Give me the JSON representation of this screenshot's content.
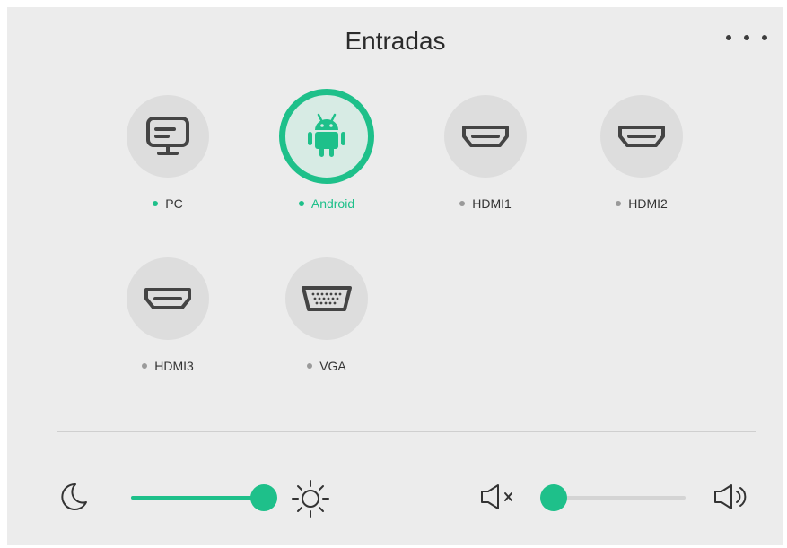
{
  "header": {
    "title": "Entradas",
    "more_icon": "more-horizontal-icon"
  },
  "sources": [
    {
      "label": "PC",
      "icon": "monitor-icon",
      "status": "available"
    },
    {
      "label": "Android",
      "icon": "android-icon",
      "status": "selected"
    },
    {
      "label": "HDMI1",
      "icon": "hdmi-icon",
      "status": "inactive"
    },
    {
      "label": "HDMI2",
      "icon": "hdmi-icon",
      "status": "inactive"
    },
    {
      "label": "HDMI3",
      "icon": "hdmi-icon",
      "status": "inactive"
    },
    {
      "label": "VGA",
      "icon": "vga-icon",
      "status": "inactive"
    }
  ],
  "controls": {
    "brightness": {
      "min_icon": "moon-icon",
      "max_icon": "sun-icon",
      "level": 1.0
    },
    "volume": {
      "min_icon": "speaker-mute-icon",
      "max_icon": "speaker-loud-icon",
      "level": 0.0
    }
  },
  "colors": {
    "accent": "#1ec08a",
    "inactive_dot": "#9a9a9a",
    "tile_bg": "#dddddd",
    "panel_bg": "#ececec"
  }
}
